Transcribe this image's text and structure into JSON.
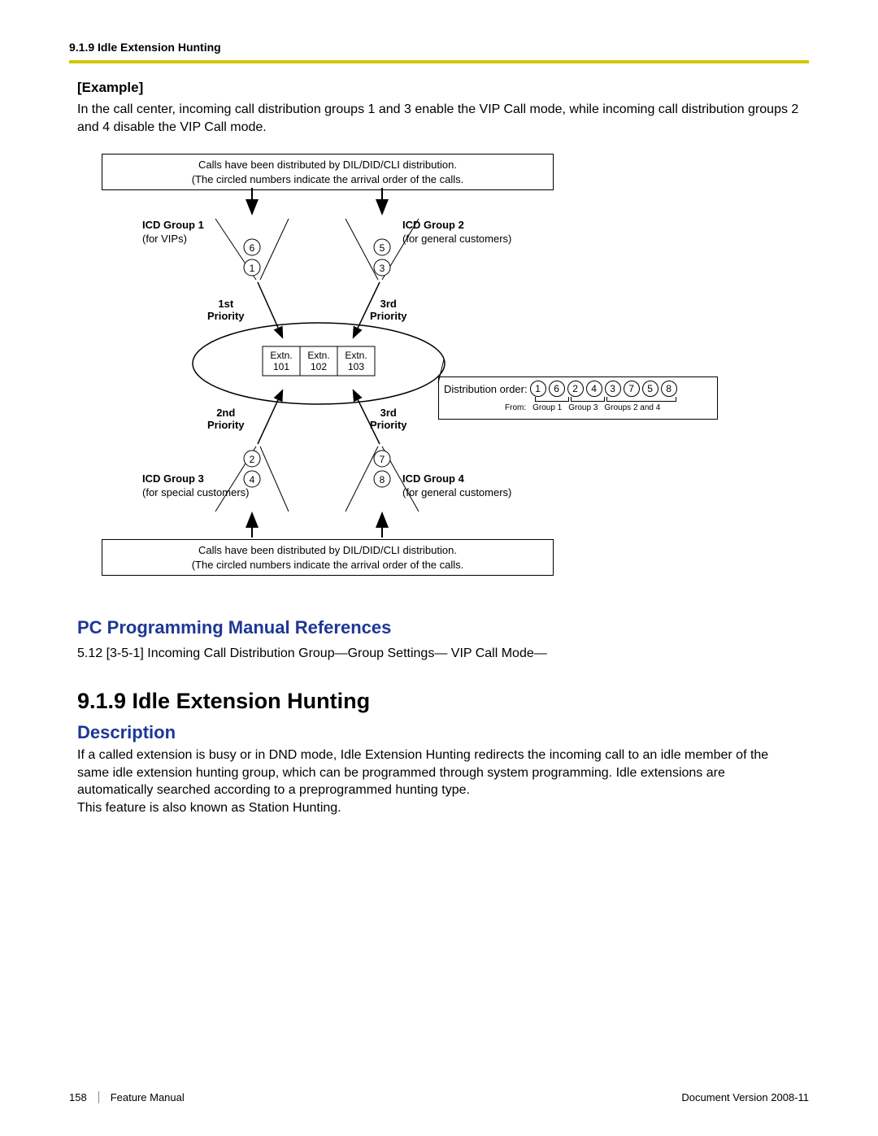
{
  "header": {
    "section": "9.1.9 Idle Extension Hunting"
  },
  "example": {
    "title": "[Example]",
    "text": "In the call center, incoming call distribution groups 1 and 3 enable the VIP Call mode, while incoming call distribution groups 2 and 4 disable the VIP Call mode."
  },
  "diagram": {
    "dist_box_line1": "Calls have been distributed by DIL/DID/CLI distribution.",
    "dist_box_line2": "(The circled numbers indicate the arrival order of the calls.",
    "groups": {
      "g1": {
        "title": "ICD Group 1",
        "sub": "(for VIPs)",
        "calls": [
          "6",
          "1"
        ]
      },
      "g2": {
        "title": "ICD Group 2",
        "sub": "(for general customers)",
        "calls": [
          "5",
          "3"
        ]
      },
      "g3": {
        "title": "ICD Group 3",
        "sub": "(for special customers)",
        "calls": [
          "2",
          "4"
        ]
      },
      "g4": {
        "title": "ICD Group 4",
        "sub": "(for general customers)",
        "calls": [
          "7",
          "8"
        ]
      }
    },
    "priorities": {
      "p1": {
        "l1": "1st",
        "l2": "Priority"
      },
      "p2a": {
        "l1": "3rd",
        "l2": "Priority"
      },
      "p2b": {
        "l1": "2nd",
        "l2": "Priority"
      },
      "p3": {
        "l1": "3rd",
        "l2": "Priority"
      }
    },
    "extensions": {
      "e1": "Extn.\n101",
      "e2": "Extn.\n102",
      "e3": "Extn.\n103"
    },
    "order": {
      "label": "Distribution order:",
      "seq": [
        "1",
        "6",
        "2",
        "4",
        "3",
        "7",
        "5",
        "8"
      ],
      "from_label": "From:",
      "from_items": [
        "Group 1",
        "Group 3",
        "Groups 2 and 4"
      ]
    }
  },
  "pc_refs": {
    "title": "PC Programming Manual References",
    "line": "5.12  [3-5-1] Incoming Call Distribution Group—Group Settings—    VIP Call Mode—"
  },
  "section_main": {
    "title": "9.1.9  Idle Extension Hunting",
    "desc_title": "Description",
    "desc": "If a called extension is busy or in DND mode, Idle Extension Hunting redirects the incoming call to an idle member of the same idle extension hunting group, which can be programmed through system programming. Idle extensions are automatically searched according to a preprogrammed hunting type.\nThis feature is also known as Station Hunting."
  },
  "footer": {
    "page": "158",
    "label": "Feature Manual",
    "version": "Document Version  2008-11"
  }
}
